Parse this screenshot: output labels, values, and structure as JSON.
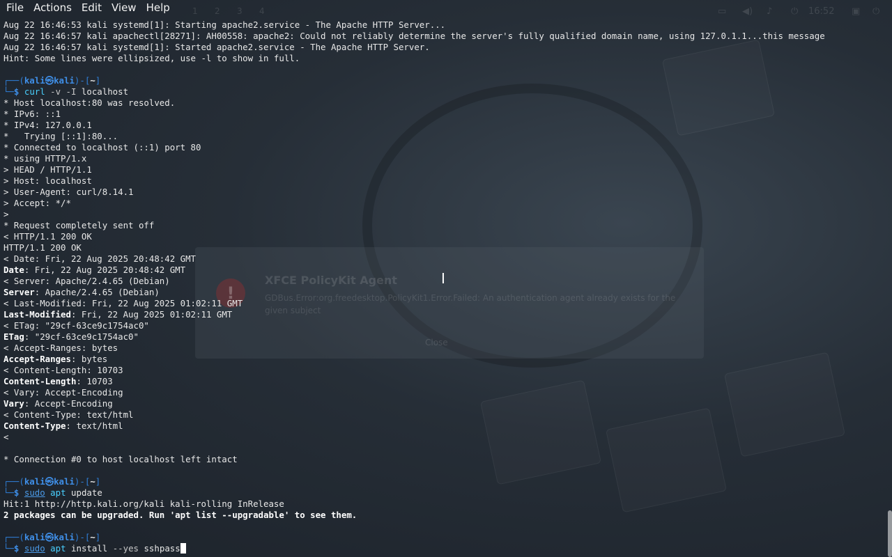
{
  "menubar": {
    "items": [
      "File",
      "Actions",
      "Edit",
      "View",
      "Help"
    ]
  },
  "panel": {
    "workspaces": [
      "1",
      "2",
      "3",
      "4"
    ],
    "clock": "16:52"
  },
  "notification": {
    "title": "XFCE PolicyKit Agent",
    "body": "GDBus.Error:org.freedesktop.PolicyKit1.Error.Failed: An authentication agent already exists for the given subject",
    "button": "Close"
  },
  "prompt": {
    "user": "kali",
    "at": "㉿",
    "host": "kali",
    "dir": "~",
    "symbol": "$"
  },
  "terminal": {
    "log_lines": [
      "Aug 22 16:46:53 kali systemd[1]: Starting apache2.service - The Apache HTTP Server...",
      "Aug 22 16:46:57 kali apachectl[28271]: AH00558: apache2: Could not reliably determine the server's fully qualified domain name, using 127.0.1.1...this message",
      "Aug 22 16:46:57 kali systemd[1]: Started apache2.service - The Apache HTTP Server.",
      "Hint: Some lines were ellipsized, use -l to show in full."
    ],
    "cmd1": {
      "tool": "curl",
      "flags": " -v -I ",
      "arg": "localhost"
    },
    "curl_verbose": [
      "* Host localhost:80 was resolved.",
      "* IPv6: ::1",
      "* IPv4: 127.0.0.1",
      "*   Trying [::1]:80...",
      "* Connected to localhost (::1) port 80",
      "* using HTTP/1.x",
      "> HEAD / HTTP/1.1",
      "> Host: localhost",
      "> User-Agent: curl/8.14.1",
      "> Accept: */*",
      ">",
      "* Request completely sent off",
      "< HTTP/1.1 200 OK",
      "HTTP/1.1 200 OK"
    ],
    "headers": [
      {
        "raw": "< Date: Fri, 22 Aug 2025 20:48:42 GMT",
        "key": "Date",
        "value": ": Fri, 22 Aug 2025 20:48:42 GMT"
      },
      {
        "raw": "< Server: Apache/2.4.65 (Debian)",
        "key": "Server",
        "value": ": Apache/2.4.65 (Debian)"
      },
      {
        "raw": "< Last-Modified: Fri, 22 Aug 2025 01:02:11 GMT",
        "key": "Last-Modified",
        "value": ": Fri, 22 Aug 2025 01:02:11 GMT"
      },
      {
        "raw": "< ETag: \"29cf-63ce9c1754ac0\"",
        "key": "ETag",
        "value": ": \"29cf-63ce9c1754ac0\""
      },
      {
        "raw": "< Accept-Ranges: bytes",
        "key": "Accept-Ranges",
        "value": ": bytes"
      },
      {
        "raw": "< Content-Length: 10703",
        "key": "Content-Length",
        "value": ": 10703"
      },
      {
        "raw": "< Vary: Accept-Encoding",
        "key": "Vary",
        "value": ": Accept-Encoding"
      },
      {
        "raw": "< Content-Type: text/html",
        "key": "Content-Type",
        "value": ": text/html"
      }
    ],
    "curl_end": [
      "<",
      "",
      "* Connection #0 to host localhost left intact"
    ],
    "cmd2": {
      "sudo": "sudo",
      "tool": "apt",
      "arg": " update"
    },
    "apt_output": "Hit:1 http://http.kali.org/kali kali-rolling InRelease",
    "apt_summary": "2 packages can be upgraded. Run 'apt list --upgradable' to see them.",
    "cmd3": {
      "sudo": "sudo",
      "tool": "apt",
      "arg": " install ",
      "flag": "--yes",
      "pkg": " sshpass"
    }
  }
}
